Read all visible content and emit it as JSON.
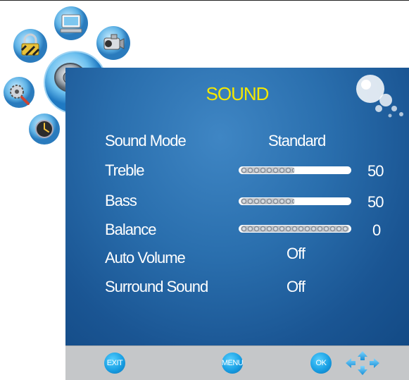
{
  "menu": {
    "title": "SOUND",
    "rows": [
      {
        "label": "Sound Mode",
        "value": "Standard"
      },
      {
        "label": "Treble",
        "value": "50",
        "level": 0.5
      },
      {
        "label": "Bass",
        "value": "50",
        "level": 0.5
      },
      {
        "label": "Balance",
        "value": "0",
        "level": 1.0
      },
      {
        "label": "Auto Volume",
        "value": "Off"
      },
      {
        "label": "Surround Sound",
        "value": "Off"
      }
    ]
  },
  "footer": {
    "exit_label": "EXIT",
    "menu_label": "MENU",
    "ok_label": "OK"
  },
  "icons": [
    "lock-icon",
    "computer-icon",
    "camcorder-icon",
    "settings-icon",
    "sound-icon",
    "clock-icon",
    "bubbles-icon",
    "direction-arrows-icon"
  ],
  "colors": {
    "title": "#f5e800",
    "panel": "#2a6fae",
    "button": "#19a0e4",
    "bar": "#c5c7c9"
  }
}
